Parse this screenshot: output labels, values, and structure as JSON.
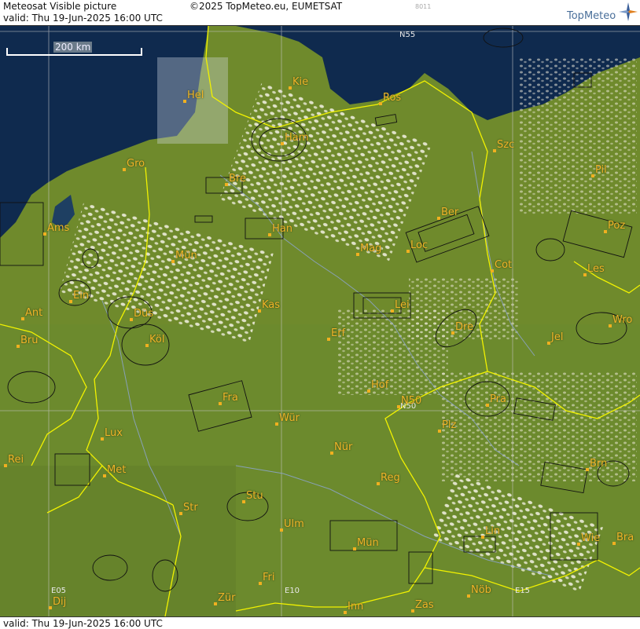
{
  "header": {
    "title": "Meteosat Visible picture",
    "copyright": "©2025 TopMeteo.eu, EUMETSAT",
    "code": "8011",
    "brand": "TopMeteo",
    "valid": "valid:  Thu  19-Jun-2025  16:00 UTC"
  },
  "footer": {
    "valid": "valid:  Thu  19-Jun-2025  16:00 UTC"
  },
  "scale": {
    "label": "200 km"
  },
  "grid_labels": [
    "N55",
    "N50",
    "E05",
    "E10",
    "E15"
  ],
  "cities": [
    "Hel",
    "Kie",
    "Ros",
    "Ham",
    "Gro",
    "Bre",
    "Szc",
    "Pil",
    "Ams",
    "Han",
    "Ber",
    "Poz",
    "Mün",
    "Mag",
    "Loc",
    "Cot",
    "Les",
    "Ein",
    "Kas",
    "Lei",
    "Ant",
    "Düs",
    "Dre",
    "Wro",
    "Bru",
    "Köl",
    "Erf",
    "Jel",
    "Hof",
    "Fra",
    "N50",
    "Pra",
    "Wür",
    "Plz",
    "Lux",
    "Nür",
    "Rei",
    "Met",
    "Reg",
    "Brn",
    "Stu",
    "Str",
    "Ulm",
    "Lin",
    "Mün",
    "Wie",
    "Bra",
    "Fri",
    "Nöb",
    "Zür",
    "Dij",
    "Inn",
    "Zas"
  ],
  "colors": {
    "sea": "#0f2a4e",
    "land": "#6f8a2c",
    "border": "#f2f200",
    "river": "#8fa6d8",
    "grid": "#c8c8c8",
    "city": "#f0b428"
  }
}
